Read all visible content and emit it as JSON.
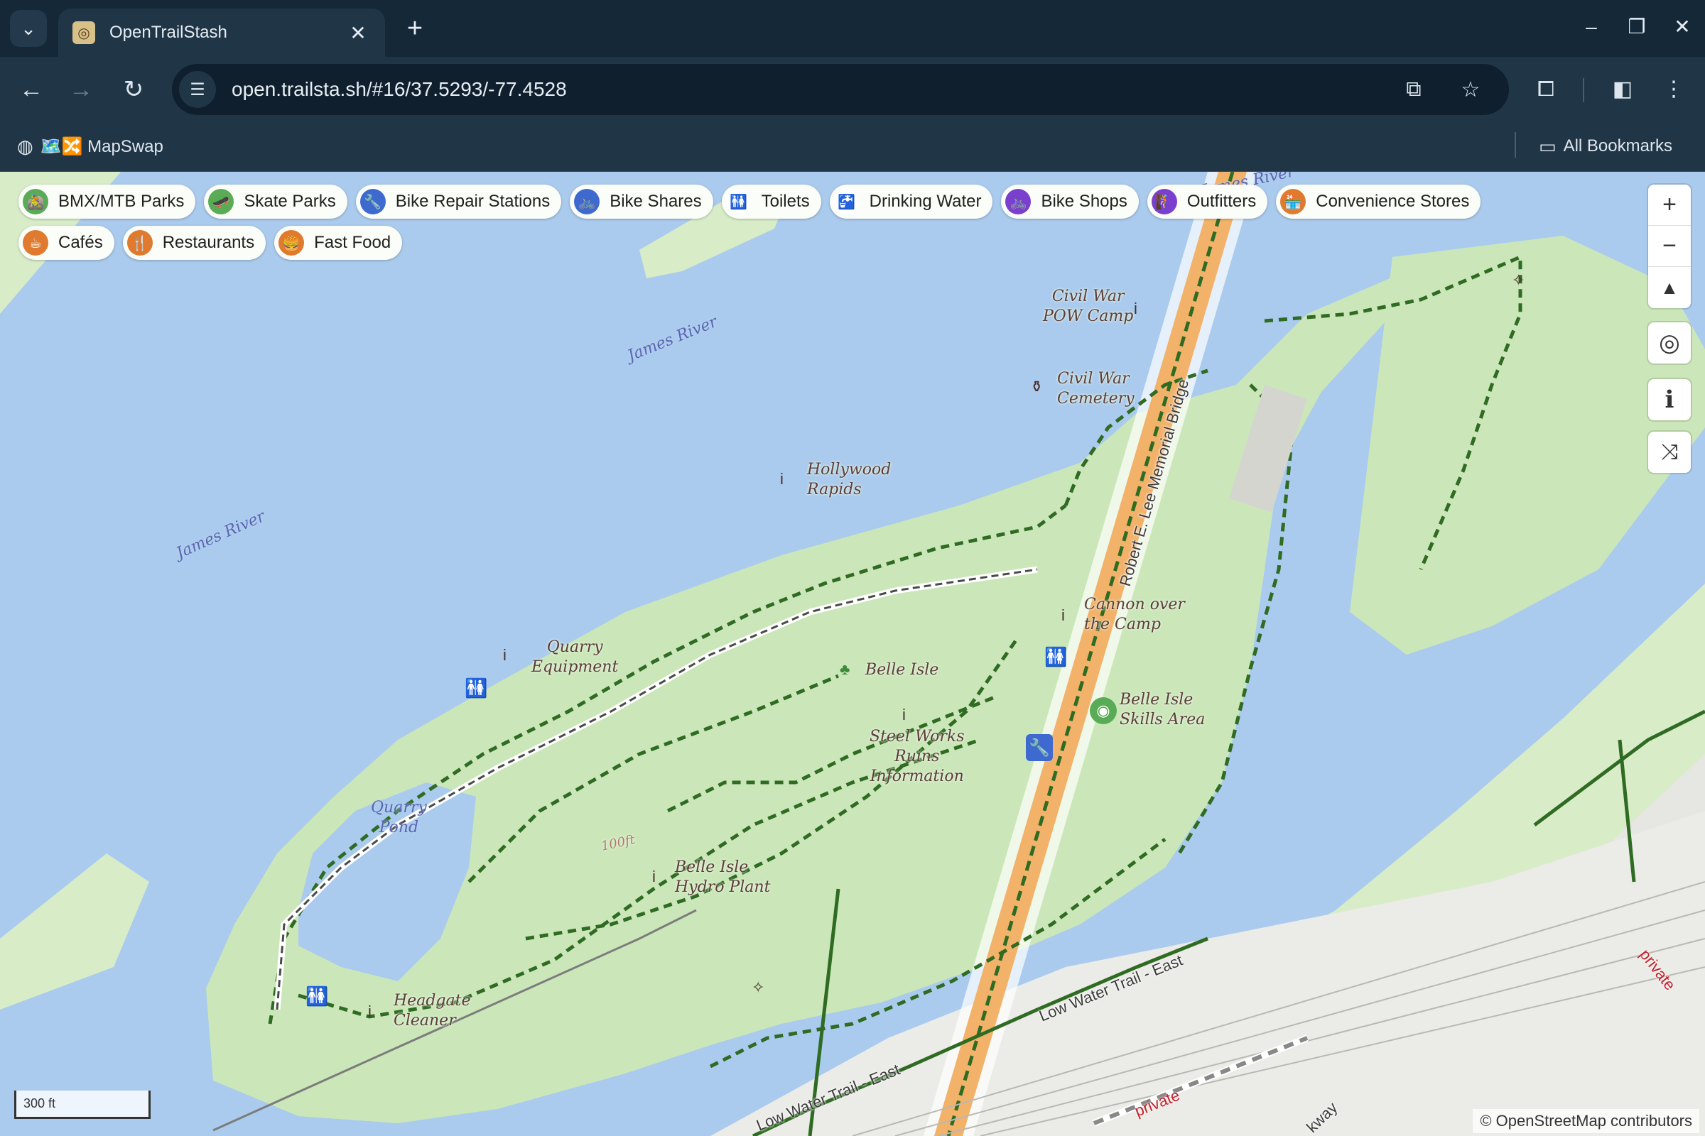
{
  "browser": {
    "tab_title": "OpenTrailStash",
    "url": "open.trailsta.sh/#16/37.5293/-77.4528",
    "bookmarks": {
      "mapswap": "🗺️🔀 MapSwap",
      "all_bookmarks": "All Bookmarks"
    }
  },
  "filters": [
    {
      "label": "BMX/MTB Parks",
      "icon": "bicycle-rider-icon",
      "color": "#5aab56"
    },
    {
      "label": "Skate Parks",
      "icon": "skateboard-icon",
      "color": "#5aab56"
    },
    {
      "label": "Bike Repair Stations",
      "icon": "wrench-icon",
      "color": "#3e6ad0"
    },
    {
      "label": "Bike Shares",
      "icon": "bicycle-icon",
      "color": "#3e6ad0"
    },
    {
      "label": "Toilets",
      "icon": "toilets-icon",
      "color": "#5b3a36"
    },
    {
      "label": "Drinking Water",
      "icon": "water-tap-icon",
      "color": "#6aa7e6"
    },
    {
      "label": "Bike Shops",
      "icon": "bicycle-icon",
      "color": "#7b3fd0"
    },
    {
      "label": "Outfitters",
      "icon": "hiker-icon",
      "color": "#7b3fd0"
    },
    {
      "label": "Convenience Stores",
      "icon": "store-icon",
      "color": "#e07a2e"
    },
    {
      "label": "Cafés",
      "icon": "coffee-cup-icon",
      "color": "#e07a2e"
    },
    {
      "label": "Restaurants",
      "icon": "fork-knife-icon",
      "color": "#e07a2e"
    },
    {
      "label": "Fast Food",
      "icon": "burger-icon",
      "color": "#e07a2e"
    }
  ],
  "map_labels": {
    "james_river_1": "James River",
    "james_river_2": "James River",
    "james_river_3": "James River",
    "civil_war_pow_camp": [
      "Civil War",
      "POW Camp"
    ],
    "civil_war_cemetery": [
      "Civil War",
      "Cemetery"
    ],
    "bridge": "Robert E. Lee Memorial Bridge",
    "hollywood_rapids": [
      "Hollywood",
      "Rapids"
    ],
    "quarry_equipment": [
      "Quarry",
      "Equipment"
    ],
    "belle_isle": "Belle Isle",
    "cannon_over_the_camp": [
      "Cannon over",
      "the Camp"
    ],
    "belle_isle_skills_area": [
      "Belle Isle",
      "Skills Area"
    ],
    "steel_works": [
      "Steel Works",
      "Ruins",
      "Information"
    ],
    "quarry_pond": [
      "Quarry",
      "Pond"
    ],
    "belle_isle_hydro_plant": [
      "Belle Isle",
      "Hydro Plant"
    ],
    "headgate_cleaner": [
      "Headgate",
      "Cleaner"
    ],
    "contour": "100ft",
    "low_water_trail_1": "Low Water Trail - East",
    "low_water_trail_2": "Low Water Trail - East",
    "private_1": "private",
    "private_2": "private",
    "parkway": "kway"
  },
  "scale_label": "300 ft",
  "attribution": "© OpenStreetMap contributors",
  "colors": {
    "water": "#aacbed",
    "park": "#cbe7b9",
    "trail": "#2f6b22",
    "highway": "#f2b26a"
  }
}
